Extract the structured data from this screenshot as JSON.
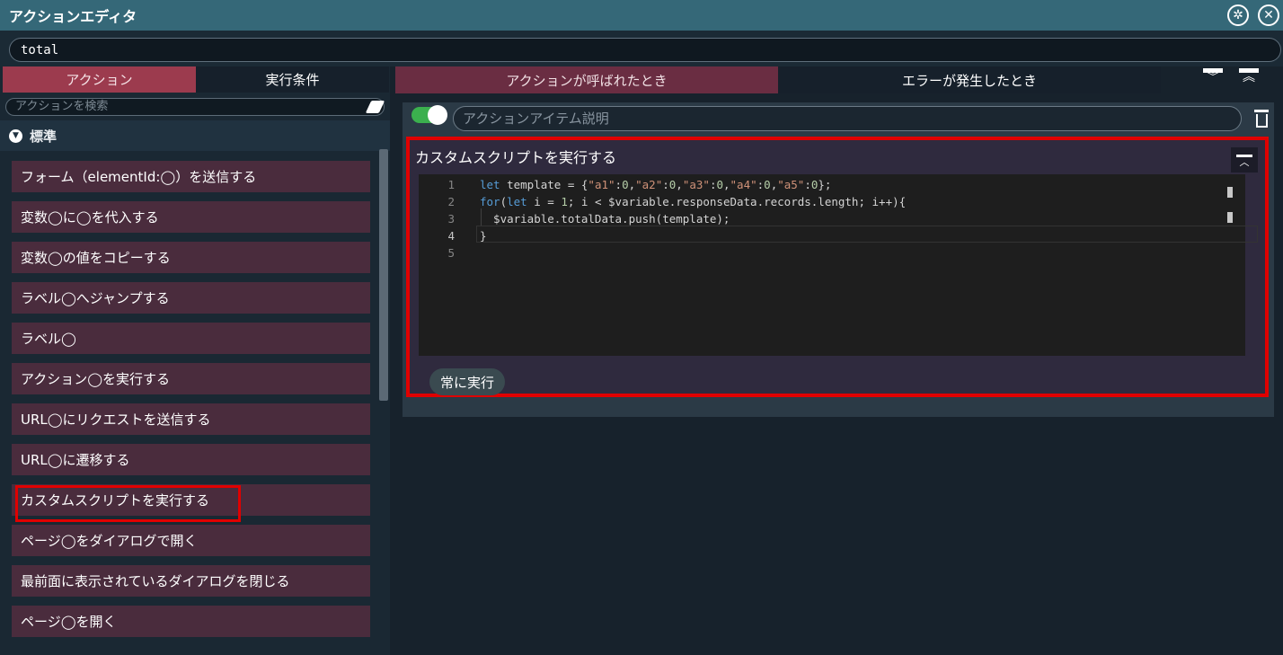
{
  "window": {
    "title": "アクションエディタ",
    "icons": [
      "settings-icon",
      "close-icon"
    ]
  },
  "action_name": {
    "value": "total"
  },
  "left_panel": {
    "tabs": [
      {
        "label": "アクション",
        "active": true
      },
      {
        "label": "実行条件",
        "active": false
      }
    ],
    "search_placeholder": "アクションを検索",
    "category": "標準",
    "items": [
      {
        "label": "フォーム（elementId:◯）を送信する"
      },
      {
        "label": "変数◯に◯を代入する"
      },
      {
        "label": "変数◯の値をコピーする"
      },
      {
        "label": "ラベル◯へジャンプする"
      },
      {
        "label": "ラベル◯"
      },
      {
        "label": "アクション◯を実行する"
      },
      {
        "label": "URL◯にリクエストを送信する"
      },
      {
        "label": "URL◯に遷移する"
      },
      {
        "label": "カスタムスクリプトを実行する",
        "highlighted": true
      },
      {
        "label": "ページ◯をダイアログで開く"
      },
      {
        "label": "最前面に表示されているダイアログを閉じる"
      },
      {
        "label": "ページ◯を開く"
      }
    ]
  },
  "right_panel": {
    "tabs": [
      {
        "label": "アクションが呼ばれたとき",
        "active": true
      },
      {
        "label": "エラーが発生したとき",
        "active": false
      }
    ],
    "item": {
      "enabled": true,
      "description_placeholder": "アクションアイテム説明",
      "card_title": "カスタムスクリプトを実行する",
      "run_condition": "常に実行",
      "code_lines": [
        {
          "number": "1",
          "text": "let template = {\"a1\":0,\"a2\":0,\"a3\":0,\"a4\":0,\"a5\":0};"
        },
        {
          "number": "2",
          "text": "for(let i = 1; i < $variable.responseData.records.length; i++){"
        },
        {
          "number": "3",
          "text": "  $variable.totalData.push(template);"
        },
        {
          "number": "4",
          "text": "}"
        },
        {
          "number": "5",
          "text": ""
        }
      ]
    }
  },
  "colors": {
    "titlebar": "#356878",
    "active_tab": "#9c3b4e",
    "list_item": "#4a2c3d",
    "highlight_border": "#e00000",
    "toggle_on": "#3bb04e"
  }
}
